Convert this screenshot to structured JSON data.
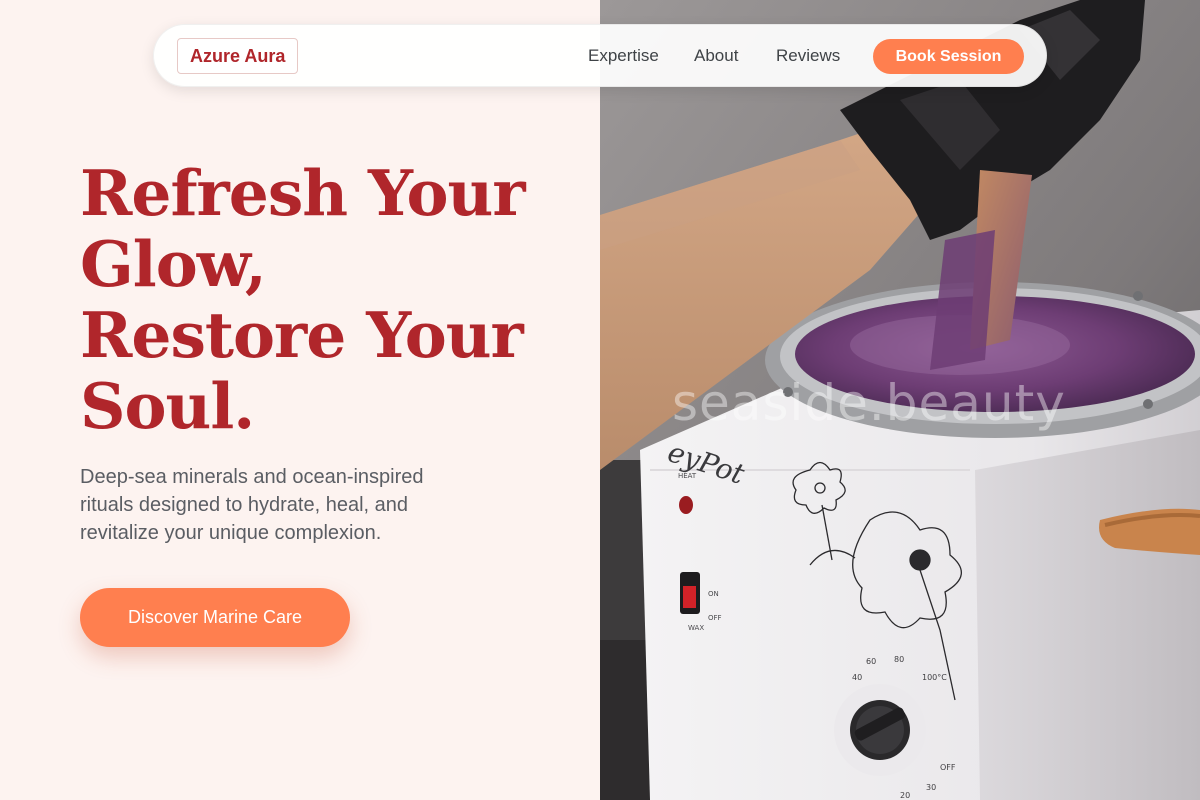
{
  "header": {
    "brand": "Azure Aura",
    "nav": [
      {
        "label": "Expertise"
      },
      {
        "label": "About"
      },
      {
        "label": "Reviews"
      }
    ],
    "cta": "Book Session"
  },
  "hero": {
    "title_lines": [
      "Refresh Your",
      "Glow,",
      "Restore Your",
      "Soul."
    ],
    "subtitle_lines": [
      "Deep-sea minerals and ocean-inspired",
      "rituals designed to hydrate, heal, and",
      "revitalize your unique complexion."
    ],
    "cta": "Discover Marine Care"
  },
  "photo": {
    "watermark": "seaside.beauty",
    "pot_labels": {
      "brand": "eyPot",
      "heat": "HEAT",
      "on": "ON",
      "off_small": "OFF",
      "wax": "WAX",
      "dial": [
        "40",
        "60",
        "80",
        "100°C",
        "OFF",
        "30",
        "20"
      ]
    }
  },
  "colors": {
    "accent": "#ff7f4f",
    "brand_red": "#b0262b",
    "background": "#fdf3f0"
  }
}
